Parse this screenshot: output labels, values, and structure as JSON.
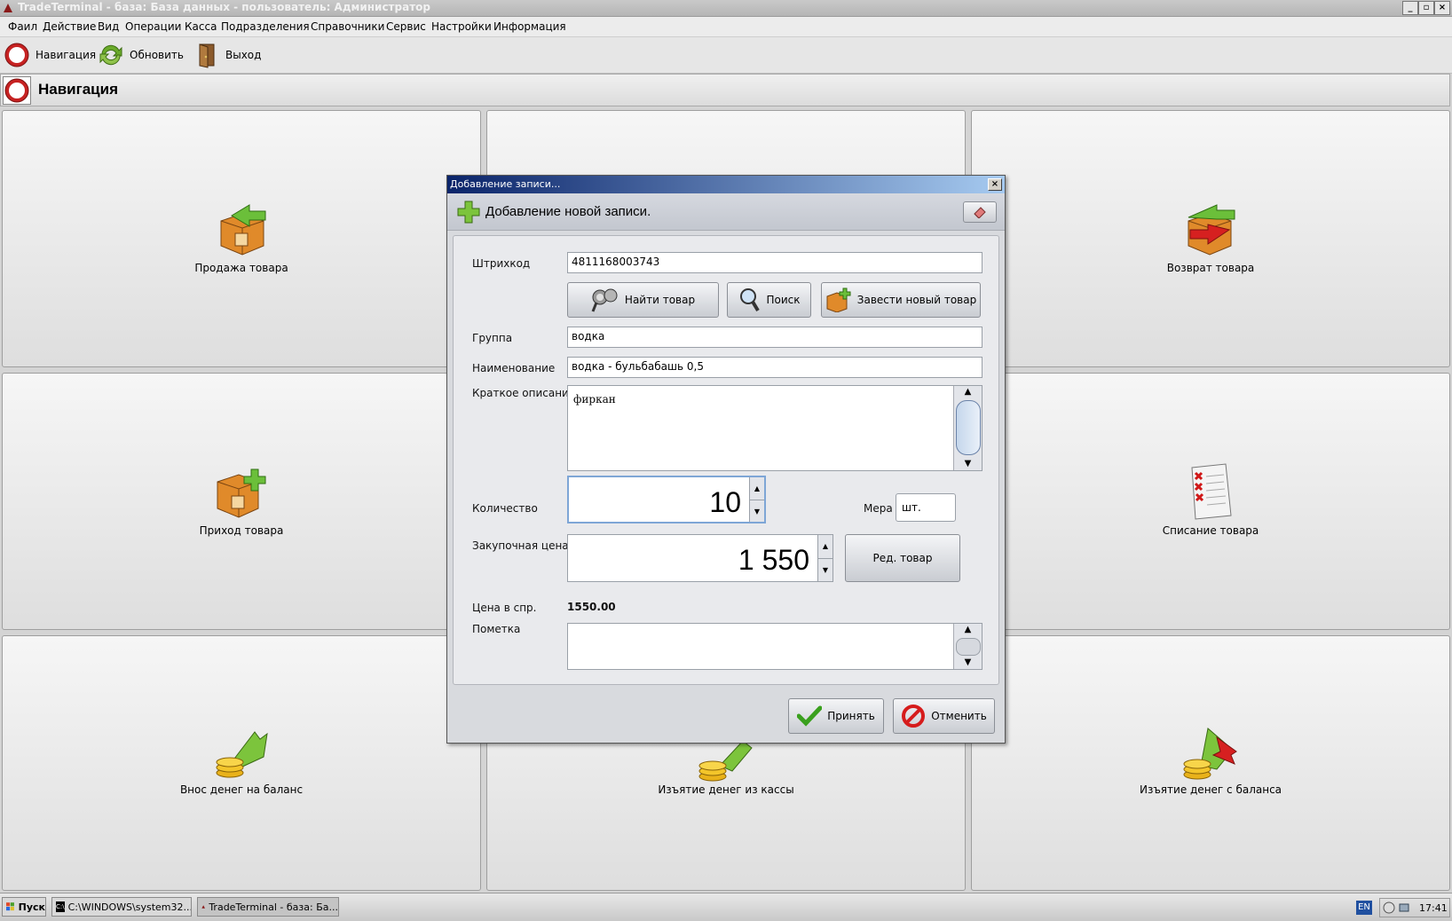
{
  "window": {
    "title": "TradeTerminal - база: База данных - пользователь: Администратор"
  },
  "menu": [
    "Фаил",
    "Действие",
    "Вид",
    "Операции",
    "Касса",
    "Подразделения",
    "Справочники",
    "Сервис",
    "Настройки",
    "Информация"
  ],
  "toolbar": {
    "navigation": "Навигация",
    "refresh": "Обновить",
    "exit": "Выход"
  },
  "nav": {
    "title": "Навигация",
    "tiles": {
      "sale": "Продажа товара",
      "return": "Возврат товара",
      "income": "Приход товара",
      "writeoff": "Списание товара",
      "deposit": "Внос денег на баланс",
      "withdraw_cash": "Изъятие денег из кассы",
      "withdraw_balance": "Изъятие денег с баланса"
    }
  },
  "dialog": {
    "window_title": "Добавление записи...",
    "header": "Добавление новой записи.",
    "labels": {
      "barcode": "Штрихкод",
      "group": "Группа",
      "name": "Наименование",
      "description": "Краткое описание",
      "quantity": "Количество",
      "unit": "Мера",
      "purchase_price": "Закупочная цена",
      "ref_price": "Цена в спр.",
      "note": "Пометка"
    },
    "values": {
      "barcode": "4811168003743",
      "group": "водка",
      "name": "водка - бульбабашь 0,5",
      "description": "фиркан",
      "quantity": "10",
      "unit": "шт.",
      "purchase_price": "1 550",
      "ref_price": "1550.00",
      "note": ""
    },
    "buttons": {
      "find": "Найти товар",
      "search": "Поиск",
      "new_item": "Завести новый товар",
      "edit_item": "Ред. товар",
      "accept": "Принять",
      "cancel": "Отменить"
    }
  },
  "taskbar": {
    "start": "Пуск",
    "tasks": [
      "C:\\WINDOWS\\system32...",
      "TradeTerminal - база: Ба..."
    ],
    "lang": "EN",
    "clock": "17:41"
  }
}
